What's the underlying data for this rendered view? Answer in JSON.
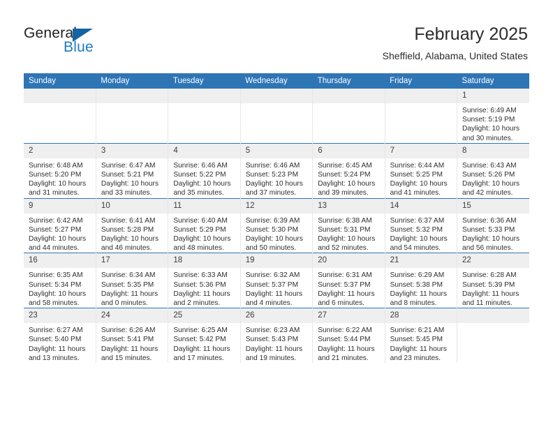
{
  "brand": {
    "name_top": "General",
    "name_bottom": "Blue",
    "triangle_icon": "triangle-icon",
    "accent_color": "#1c7cc0",
    "logo_dark_color": "#231f20"
  },
  "header": {
    "title": "February 2025",
    "subtitle": "Sheffield, Alabama, United States"
  },
  "theme": {
    "header_blue": "#2e75b6",
    "daynum_band": "#efefef",
    "cell_divider": "#e6e6e6",
    "text": "#2f2f2f"
  },
  "columns": [
    "Sunday",
    "Monday",
    "Tuesday",
    "Wednesday",
    "Thursday",
    "Friday",
    "Saturday"
  ],
  "labels": {
    "sunrise": "Sunrise:",
    "sunset": "Sunset:",
    "daylight": "Daylight:"
  },
  "weeks": [
    [
      {
        "empty": true
      },
      {
        "empty": true
      },
      {
        "empty": true
      },
      {
        "empty": true
      },
      {
        "empty": true
      },
      {
        "empty": true
      },
      {
        "day": "1",
        "sunrise": "Sunrise: 6:49 AM",
        "sunset": "Sunset: 5:19 PM",
        "daylight": "Daylight: 10 hours and 30 minutes."
      }
    ],
    [
      {
        "day": "2",
        "sunrise": "Sunrise: 6:48 AM",
        "sunset": "Sunset: 5:20 PM",
        "daylight": "Daylight: 10 hours and 31 minutes."
      },
      {
        "day": "3",
        "sunrise": "Sunrise: 6:47 AM",
        "sunset": "Sunset: 5:21 PM",
        "daylight": "Daylight: 10 hours and 33 minutes."
      },
      {
        "day": "4",
        "sunrise": "Sunrise: 6:46 AM",
        "sunset": "Sunset: 5:22 PM",
        "daylight": "Daylight: 10 hours and 35 minutes."
      },
      {
        "day": "5",
        "sunrise": "Sunrise: 6:46 AM",
        "sunset": "Sunset: 5:23 PM",
        "daylight": "Daylight: 10 hours and 37 minutes."
      },
      {
        "day": "6",
        "sunrise": "Sunrise: 6:45 AM",
        "sunset": "Sunset: 5:24 PM",
        "daylight": "Daylight: 10 hours and 39 minutes."
      },
      {
        "day": "7",
        "sunrise": "Sunrise: 6:44 AM",
        "sunset": "Sunset: 5:25 PM",
        "daylight": "Daylight: 10 hours and 41 minutes."
      },
      {
        "day": "8",
        "sunrise": "Sunrise: 6:43 AM",
        "sunset": "Sunset: 5:26 PM",
        "daylight": "Daylight: 10 hours and 42 minutes."
      }
    ],
    [
      {
        "day": "9",
        "sunrise": "Sunrise: 6:42 AM",
        "sunset": "Sunset: 5:27 PM",
        "daylight": "Daylight: 10 hours and 44 minutes."
      },
      {
        "day": "10",
        "sunrise": "Sunrise: 6:41 AM",
        "sunset": "Sunset: 5:28 PM",
        "daylight": "Daylight: 10 hours and 46 minutes."
      },
      {
        "day": "11",
        "sunrise": "Sunrise: 6:40 AM",
        "sunset": "Sunset: 5:29 PM",
        "daylight": "Daylight: 10 hours and 48 minutes."
      },
      {
        "day": "12",
        "sunrise": "Sunrise: 6:39 AM",
        "sunset": "Sunset: 5:30 PM",
        "daylight": "Daylight: 10 hours and 50 minutes."
      },
      {
        "day": "13",
        "sunrise": "Sunrise: 6:38 AM",
        "sunset": "Sunset: 5:31 PM",
        "daylight": "Daylight: 10 hours and 52 minutes."
      },
      {
        "day": "14",
        "sunrise": "Sunrise: 6:37 AM",
        "sunset": "Sunset: 5:32 PM",
        "daylight": "Daylight: 10 hours and 54 minutes."
      },
      {
        "day": "15",
        "sunrise": "Sunrise: 6:36 AM",
        "sunset": "Sunset: 5:33 PM",
        "daylight": "Daylight: 10 hours and 56 minutes."
      }
    ],
    [
      {
        "day": "16",
        "sunrise": "Sunrise: 6:35 AM",
        "sunset": "Sunset: 5:34 PM",
        "daylight": "Daylight: 10 hours and 58 minutes."
      },
      {
        "day": "17",
        "sunrise": "Sunrise: 6:34 AM",
        "sunset": "Sunset: 5:35 PM",
        "daylight": "Daylight: 11 hours and 0 minutes."
      },
      {
        "day": "18",
        "sunrise": "Sunrise: 6:33 AM",
        "sunset": "Sunset: 5:36 PM",
        "daylight": "Daylight: 11 hours and 2 minutes."
      },
      {
        "day": "19",
        "sunrise": "Sunrise: 6:32 AM",
        "sunset": "Sunset: 5:37 PM",
        "daylight": "Daylight: 11 hours and 4 minutes."
      },
      {
        "day": "20",
        "sunrise": "Sunrise: 6:31 AM",
        "sunset": "Sunset: 5:37 PM",
        "daylight": "Daylight: 11 hours and 6 minutes."
      },
      {
        "day": "21",
        "sunrise": "Sunrise: 6:29 AM",
        "sunset": "Sunset: 5:38 PM",
        "daylight": "Daylight: 11 hours and 8 minutes."
      },
      {
        "day": "22",
        "sunrise": "Sunrise: 6:28 AM",
        "sunset": "Sunset: 5:39 PM",
        "daylight": "Daylight: 11 hours and 11 minutes."
      }
    ],
    [
      {
        "day": "23",
        "sunrise": "Sunrise: 6:27 AM",
        "sunset": "Sunset: 5:40 PM",
        "daylight": "Daylight: 11 hours and 13 minutes."
      },
      {
        "day": "24",
        "sunrise": "Sunrise: 6:26 AM",
        "sunset": "Sunset: 5:41 PM",
        "daylight": "Daylight: 11 hours and 15 minutes."
      },
      {
        "day": "25",
        "sunrise": "Sunrise: 6:25 AM",
        "sunset": "Sunset: 5:42 PM",
        "daylight": "Daylight: 11 hours and 17 minutes."
      },
      {
        "day": "26",
        "sunrise": "Sunrise: 6:23 AM",
        "sunset": "Sunset: 5:43 PM",
        "daylight": "Daylight: 11 hours and 19 minutes."
      },
      {
        "day": "27",
        "sunrise": "Sunrise: 6:22 AM",
        "sunset": "Sunset: 5:44 PM",
        "daylight": "Daylight: 11 hours and 21 minutes."
      },
      {
        "day": "28",
        "sunrise": "Sunrise: 6:21 AM",
        "sunset": "Sunset: 5:45 PM",
        "daylight": "Daylight: 11 hours and 23 minutes."
      },
      {
        "empty": true
      }
    ]
  ]
}
